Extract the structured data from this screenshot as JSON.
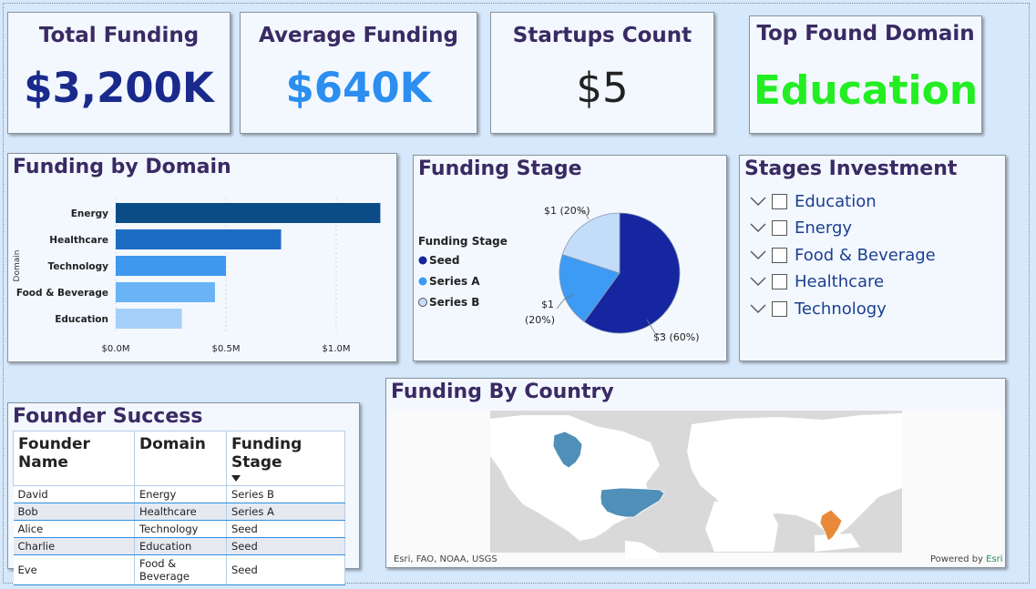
{
  "kpis": {
    "total_funding": {
      "title": "Total Funding",
      "value": "$3,200K",
      "color": "#1a2a8c"
    },
    "average_funding": {
      "title": "Average Funding",
      "value": "$640K",
      "color": "#2b8ef0"
    },
    "startups_count": {
      "title": "Startups Count",
      "value": "$5",
      "color": "#222222"
    },
    "top_domain": {
      "title": "Top Found Domain",
      "value": "Education",
      "color": "#22ee22"
    }
  },
  "domain_chart": {
    "title": "Funding by Domain",
    "ylabel": "Domain",
    "ticks": [
      "$0.0M",
      "$0.5M",
      "$1.0M"
    ],
    "colors": [
      "#0b4c86",
      "#1c6cc4",
      "#3d98ee",
      "#6ab3f5",
      "#a5cff8"
    ]
  },
  "stage_chart": {
    "title": "Funding Stage",
    "legend_title": "Funding Stage",
    "legend": [
      {
        "label": "Seed",
        "color": "#1526a0"
      },
      {
        "label": "Series A",
        "color": "#3d9bf5"
      },
      {
        "label": "Series B",
        "color": "#c3dcfa"
      }
    ],
    "labels": {
      "seed": "$3 (60%)",
      "series_a_1": "$1",
      "series_a_2": "(20%)",
      "series_b": "$1 (20%)"
    }
  },
  "slicer": {
    "title": "Stages Investment",
    "items": [
      "Education",
      "Energy",
      "Food & Beverage",
      "Healthcare",
      "Technology"
    ]
  },
  "founder_table": {
    "title": "Founder Success",
    "headers": [
      "Founder Name",
      "Domain",
      "Funding Stage"
    ],
    "rows": [
      [
        "David",
        "Energy",
        "Series B"
      ],
      [
        "Bob",
        "Healthcare",
        "Series A"
      ],
      [
        "Alice",
        "Technology",
        "Seed"
      ],
      [
        "Charlie",
        "Education",
        "Seed"
      ],
      [
        "Eve",
        "Food & Beverage",
        "Seed"
      ]
    ]
  },
  "map": {
    "title": "Funding By Country",
    "attribution": "Esri, FAO, NOAA, USGS",
    "powered_prefix": "Powered by ",
    "powered_link": "Esri",
    "colors": {
      "usa": "#4f8fb8",
      "india": "#e88a3a",
      "land": "#ffffff",
      "water": "#dcdcdc"
    }
  },
  "chart_data": [
    {
      "type": "bar",
      "title": "Funding by Domain",
      "ylabel": "Domain",
      "categories": [
        "Energy",
        "Healthcare",
        "Technology",
        "Food & Beverage",
        "Education"
      ],
      "values": [
        1.2,
        0.75,
        0.5,
        0.45,
        0.3
      ],
      "unit": "$M",
      "xlim": [
        0,
        1.2
      ]
    },
    {
      "type": "pie",
      "title": "Funding Stage",
      "categories": [
        "Seed",
        "Series A",
        "Series B"
      ],
      "values": [
        3,
        1,
        1
      ],
      "percent": [
        60,
        20,
        20
      ]
    }
  ]
}
